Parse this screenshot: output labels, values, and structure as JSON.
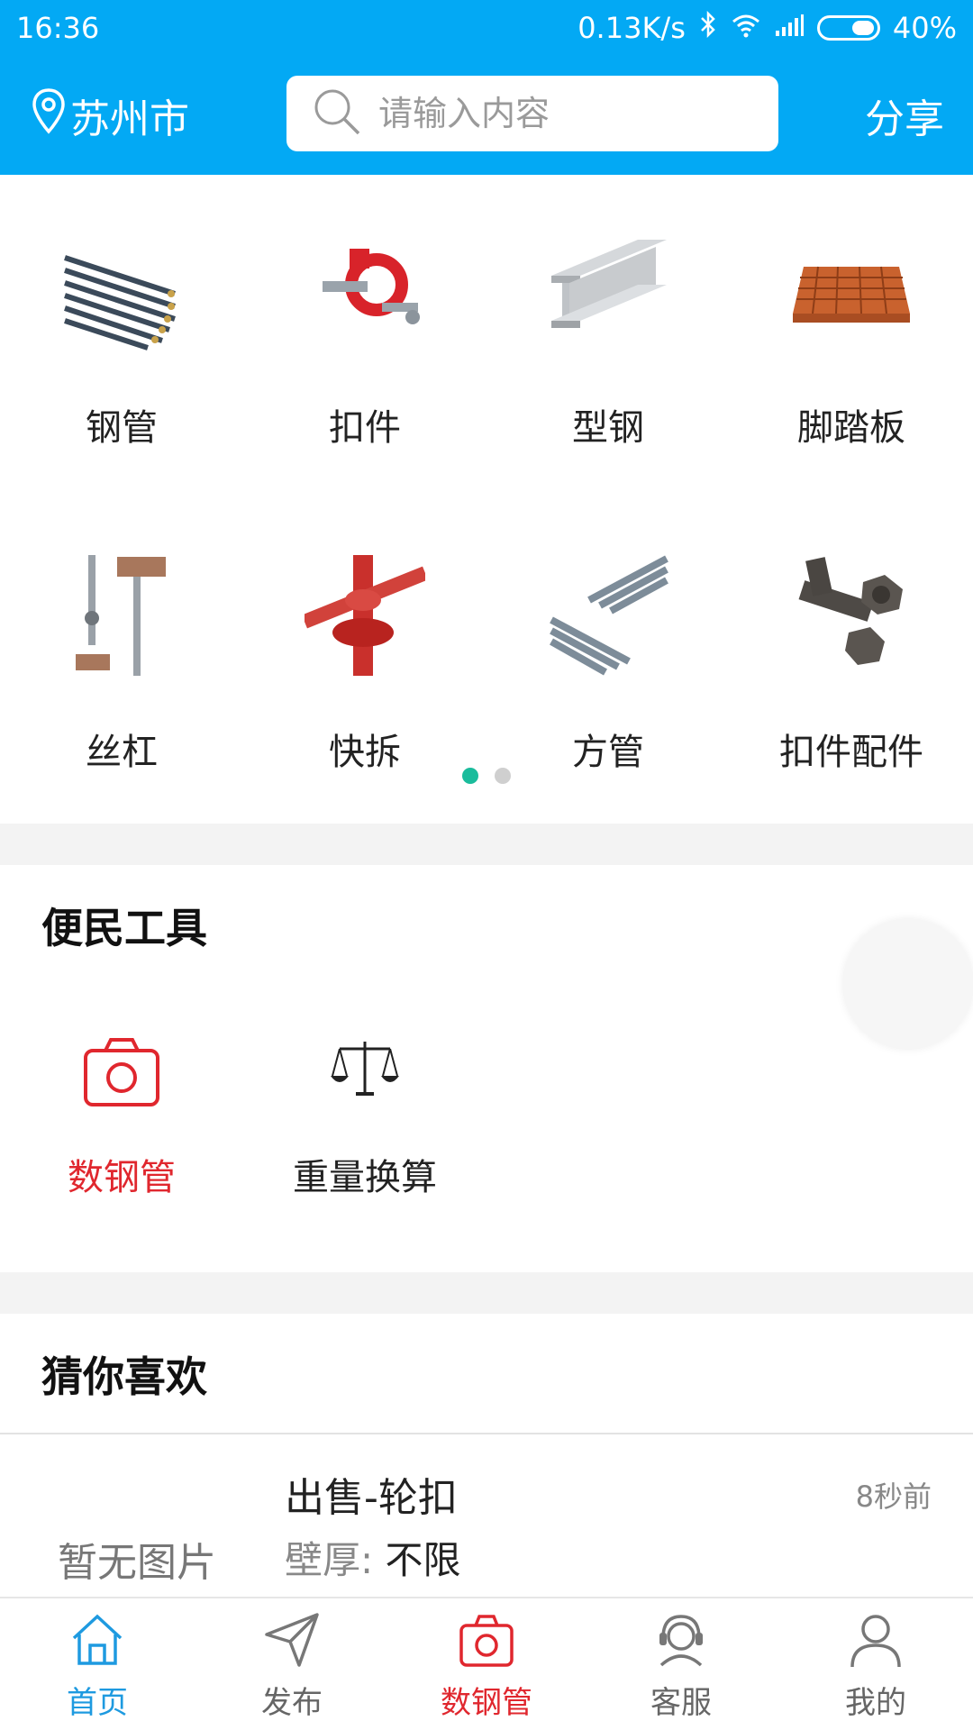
{
  "status_bar": {
    "time": "16:36",
    "speed": "0.13K/s",
    "battery": "40%"
  },
  "header": {
    "location": "苏州市",
    "search_placeholder": "请输入内容",
    "share_label": "分享"
  },
  "categories": [
    {
      "label": "钢管",
      "icon": "steel-pipe-icon"
    },
    {
      "label": "扣件",
      "icon": "coupler-icon"
    },
    {
      "label": "型钢",
      "icon": "i-beam-icon"
    },
    {
      "label": "脚踏板",
      "icon": "scaffold-board-icon"
    },
    {
      "label": "丝杠",
      "icon": "screw-jack-icon"
    },
    {
      "label": "快拆",
      "icon": "quick-release-icon"
    },
    {
      "label": "方管",
      "icon": "square-tube-icon"
    },
    {
      "label": "扣件配件",
      "icon": "bolt-icon"
    }
  ],
  "pager": {
    "active_index": 0,
    "count": 2
  },
  "tools": {
    "title": "便民工具",
    "items": [
      {
        "label": "数钢管",
        "icon": "camera-icon",
        "color": "#e0272e"
      },
      {
        "label": "重量换算",
        "icon": "scale-icon",
        "color": "#222222"
      }
    ]
  },
  "guess": {
    "title": "猜你喜欢",
    "post": {
      "no_image": "暂无图片",
      "title": "出售-轮扣",
      "time": "8秒前",
      "spec_label": "壁厚:",
      "spec_value": "不限"
    }
  },
  "nav": [
    {
      "label": "首页",
      "icon": "home-icon",
      "state": "active"
    },
    {
      "label": "发布",
      "icon": "send-icon",
      "state": "normal"
    },
    {
      "label": "数钢管",
      "icon": "camera-icon",
      "state": "red"
    },
    {
      "label": "客服",
      "icon": "headset-icon",
      "state": "normal"
    },
    {
      "label": "我的",
      "icon": "user-icon",
      "state": "normal"
    }
  ],
  "colors": {
    "brand": "#03a9f4",
    "accent_red": "#e0272e",
    "nav_active": "#1e9ae0",
    "pager_active": "#1abc9c"
  }
}
